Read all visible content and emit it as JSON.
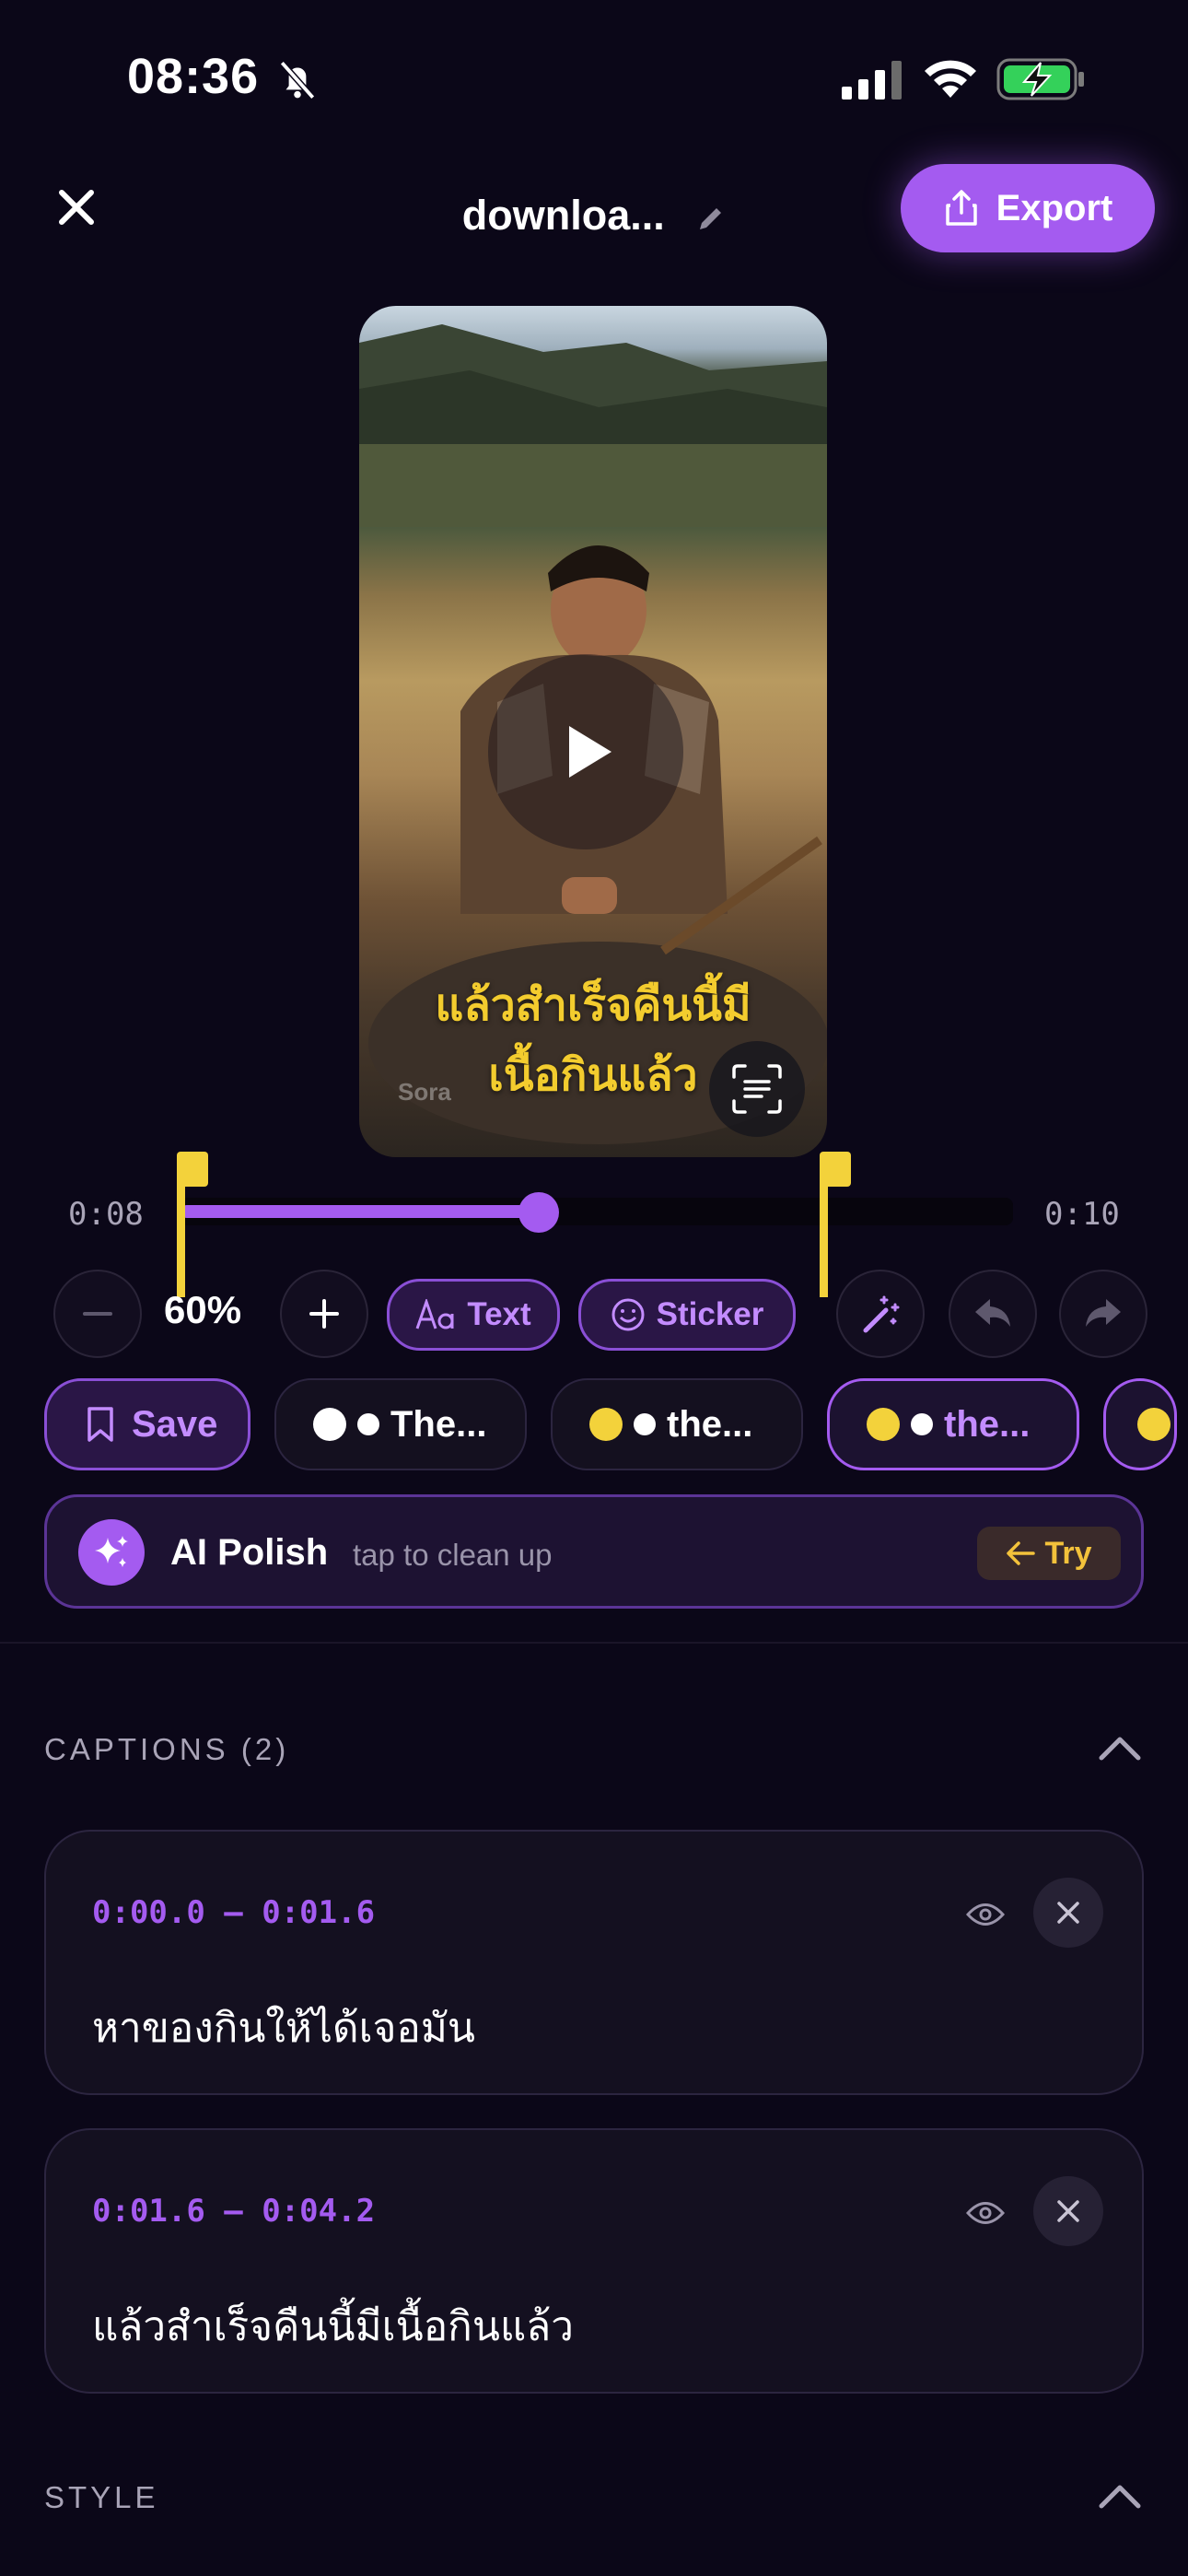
{
  "status_bar": {
    "time": "08:36",
    "icons": [
      "bell-slash-icon",
      "signal-icon",
      "wifi-icon",
      "battery-charging-icon"
    ]
  },
  "header": {
    "title": "downloa...",
    "export_label": "Export"
  },
  "video": {
    "caption_line1": "แล้วสำเร็จคืนนี้มี",
    "caption_line2": "เนื้อกินแล้ว",
    "watermark": "Sora"
  },
  "timeline": {
    "start_time": "0:08",
    "end_time": "0:10",
    "playhead_fraction": 0.43
  },
  "toolbar": {
    "zoom_value": "60%",
    "text_label": "Text",
    "sticker_label": "Sticker"
  },
  "presets": {
    "save_label": "Save",
    "items": [
      {
        "label": "The...",
        "dot_color": "#ffffff",
        "active": false
      },
      {
        "label": "the...",
        "dot_color": "#f3d23b",
        "active": false
      },
      {
        "label": "the...",
        "dot_color": "#f3d23b",
        "active": true
      }
    ]
  },
  "ai_polish": {
    "title": "AI Polish",
    "subtitle": "tap to clean up",
    "try_label": "Try"
  },
  "captions_section": {
    "label": "CAPTIONS (2)",
    "items": [
      {
        "time": "0:00.0 – 0:01.6",
        "text": "หาของกินให้ได้เจอมัน"
      },
      {
        "time": "0:01.6 – 0:04.2",
        "text": "แล้วสำเร็จคืนนี้มีเนื้อกินแล้ว"
      }
    ]
  },
  "style_section": {
    "label": "STYLE"
  },
  "colors": {
    "accent": "#a45bf0",
    "caption_yellow": "#f3cc2e",
    "background": "#0b0718"
  }
}
